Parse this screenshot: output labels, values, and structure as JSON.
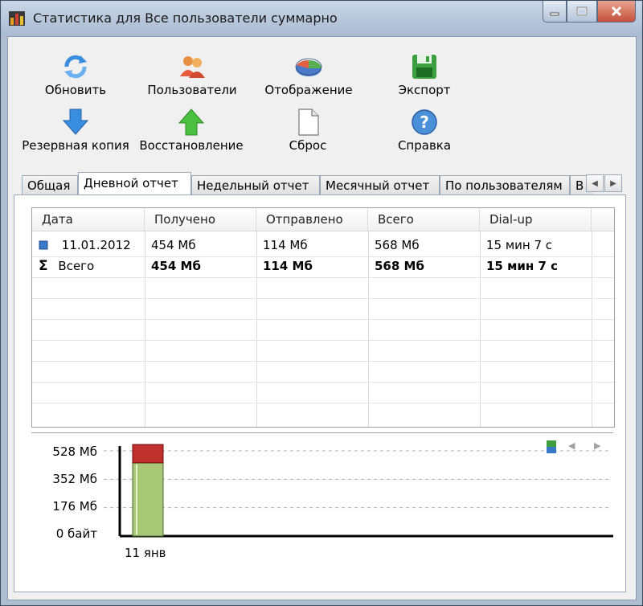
{
  "window": {
    "title": "Статистика для Все пользователи суммарно"
  },
  "toolbar": {
    "refresh": "Обновить",
    "users": "Пользователи",
    "display": "Отображение",
    "export": "Экспорт",
    "backup": "Резервная копия",
    "restore": "Восстановление",
    "reset": "Сброс",
    "help": "Справка"
  },
  "tabs": [
    {
      "label": "Общая",
      "active": false
    },
    {
      "label": "Дневной отчет",
      "active": true
    },
    {
      "label": "Недельный отчет",
      "active": false
    },
    {
      "label": "Месячный отчет",
      "active": false
    },
    {
      "label": "По пользователям",
      "active": false
    },
    {
      "label": "В",
      "active": false
    }
  ],
  "table": {
    "columns": [
      "Дата",
      "Получено",
      "Отправлено",
      "Всего",
      "Dial-up"
    ],
    "rows": [
      {
        "date": "11.01.2012",
        "received": "454 Мб",
        "sent": "114 Мб",
        "total": "568 Мб",
        "dialup": "15 мин 7 с"
      }
    ],
    "summary": {
      "label": "Всего",
      "symbol": "Σ",
      "received": "454 Мб",
      "sent": "114 Мб",
      "total": "568 Мб",
      "dialup": "15 мин 7 с"
    }
  },
  "chart_data": {
    "type": "bar",
    "categories": [
      "11 янв"
    ],
    "series": [
      {
        "values": [
          454
        ]
      },
      {
        "values": [
          114
        ]
      }
    ],
    "y_tick_labels": [
      "0 байт",
      "176 Мб",
      "352 Мб",
      "528 Мб"
    ],
    "y_ticks": [
      0,
      176,
      352,
      528
    ],
    "ylim": [
      0,
      568
    ],
    "grid": true,
    "colors": [
      "#a8c878",
      "#c0302c"
    ]
  },
  "colors": {
    "accent": "#3a78c8",
    "received_bar": "#a8c878",
    "sent_bar": "#c0302c"
  }
}
